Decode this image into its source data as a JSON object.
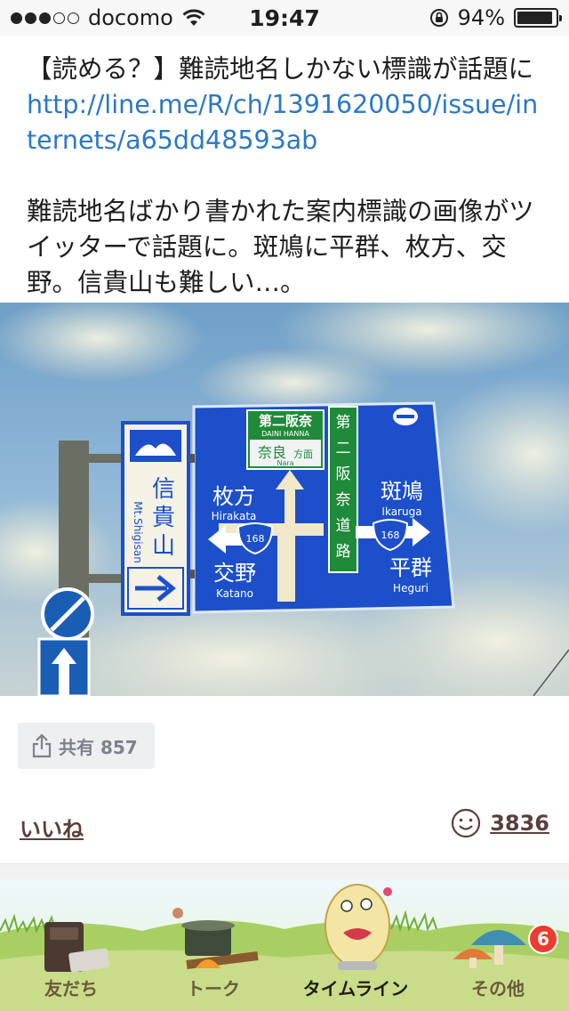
{
  "status_bar": {
    "signal_dots_filled": 3,
    "signal_dots_total": 5,
    "carrier": "docomo",
    "wifi_icon": "wifi-icon",
    "time": "19:47",
    "rotation_lock_icon": "rotation-lock-icon",
    "battery_text": "94%",
    "battery_level": 0.94
  },
  "post": {
    "title": "【読める？】難読地名しかない標識が話題に",
    "link": "http://line.me/R/ch/1391620050/issue/internets/a65dd48593ab",
    "description": "難読地名ばかり書かれた案内標識の画像がツイッターで話題に。斑鳩に平群、枚方、交野。信貴山も難しい…。"
  },
  "photo": {
    "side_sign": {
      "jp": "信貴山",
      "en": "Mt.Shigisan"
    },
    "main_sign": {
      "top_route_jp": "第二阪奈",
      "top_route_en": "DAINI HANNA",
      "top_dest_jp": "奈良",
      "top_dest_suffix": "方面",
      "top_dest_en": "Nara",
      "vertical_route": [
        "第",
        "二",
        "阪",
        "奈",
        "道",
        "路"
      ],
      "left_top_jp": "枚方",
      "left_top_en": "Hirakata",
      "left_bottom_jp": "交野",
      "left_bottom_en": "Katano",
      "right_top_jp": "斑鳩",
      "right_top_en": "Ikaruga",
      "right_bottom_jp": "平群",
      "right_bottom_en": "Heguri",
      "route_number": "168"
    }
  },
  "actions": {
    "share_label": "共有 857",
    "like_label": "いいね",
    "reaction_count": "3836",
    "share_icon": "share-icon",
    "smiley_icon": "smiley-icon"
  },
  "tabbar": {
    "tabs": [
      {
        "label": "友だち",
        "icon": "friends-icon",
        "active": false
      },
      {
        "label": "トーク",
        "icon": "talk-icon",
        "active": false
      },
      {
        "label": "タイムライン",
        "icon": "timeline-icon",
        "active": true
      },
      {
        "label": "その他",
        "icon": "more-icon",
        "active": false
      }
    ],
    "more_badge": "6"
  },
  "colors": {
    "link": "#2b78c5",
    "sign_blue": "#1c4fc9",
    "sign_green": "#1e8a3a",
    "badge_red": "#ef3b2d"
  }
}
